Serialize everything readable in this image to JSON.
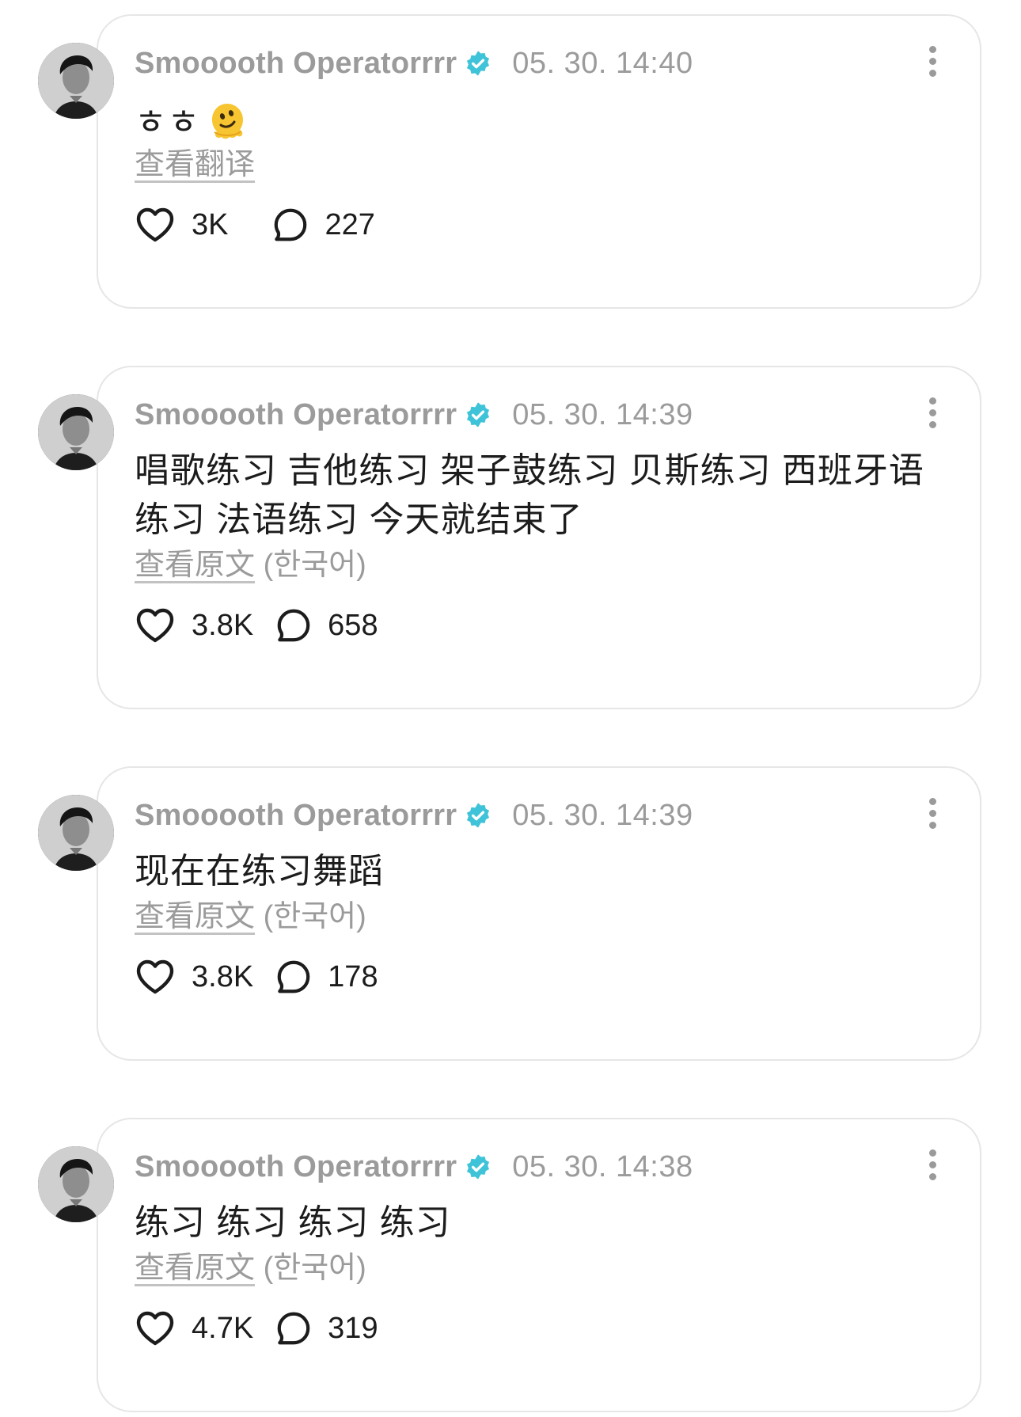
{
  "posts": [
    {
      "username": "Smooooth Operatorrrr",
      "time": "05. 30. 14:40",
      "content": "ㅎㅎ",
      "emoji": "melting-face",
      "translate_link": "查看翻译",
      "translate_lang": "",
      "likes": "3K",
      "comments": "227"
    },
    {
      "username": "Smooooth Operatorrrr",
      "time": "05. 30. 14:39",
      "content_lines": [
        "唱歌练习 吉他练习 架子鼓练习 贝斯练习 西班牙语",
        "练习 法语练习 今天就结束了"
      ],
      "translate_link": "查看原文",
      "translate_lang": "(한국어)",
      "likes": "3.8K",
      "comments": "658"
    },
    {
      "username": "Smooooth Operatorrrr",
      "time": "05. 30. 14:39",
      "content": "现在在练习舞蹈",
      "translate_link": "查看原文",
      "translate_lang": "(한국어)",
      "likes": "3.8K",
      "comments": "178"
    },
    {
      "username": "Smooooth Operatorrrr",
      "time": "05. 30. 14:38",
      "content": "练习 练习 练习 练习",
      "translate_link": "查看原文",
      "translate_lang": "(한국어)",
      "likes": "4.7K",
      "comments": "319"
    }
  ],
  "colors": {
    "verified_badge": "#3ec3d8",
    "muted_text": "#9b9b9b",
    "card_border": "#e6e6e6"
  }
}
